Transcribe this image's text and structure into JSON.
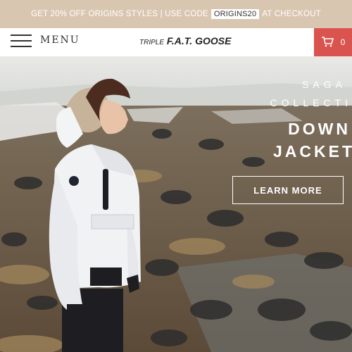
{
  "promo": {
    "text_before": "GET 20% OFF ORIGINS STYLES | USE CODE",
    "code": "ORIGINS20",
    "text_after": "AT CHECKOUT"
  },
  "header": {
    "menu_label": "MENU",
    "logo_small": "TRIPLE",
    "logo_main": "F.A.T.",
    "logo_end": "GOOSE",
    "cart_count": "0",
    "cart_icon": "shopping-cart-icon",
    "cart_color": "#d9534f"
  },
  "hero": {
    "subtitle_line1": "SAGA",
    "subtitle_line2": "COLLECTI",
    "title_line1": "DOWN",
    "title_line2": "JACKET",
    "cta_label": "LEARN MORE"
  },
  "colors": {
    "promo_bg": "#d9c6b0",
    "accent": "#d9534f"
  }
}
